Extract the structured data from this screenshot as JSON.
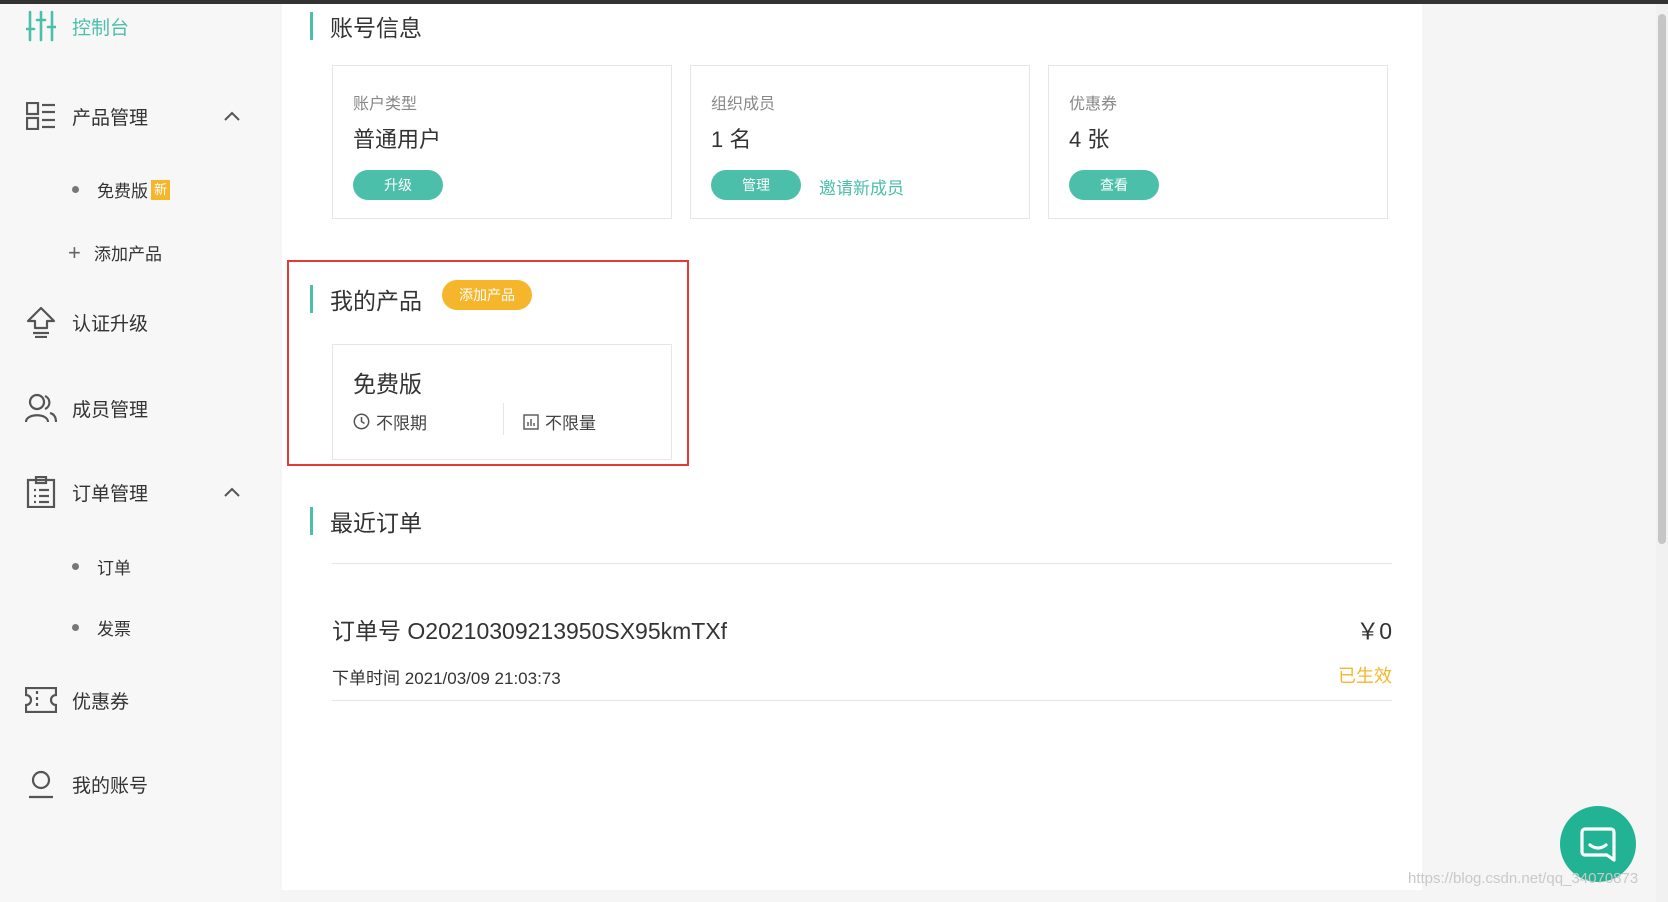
{
  "colors": {
    "accent": "#4cbfab",
    "warning": "#f5b62b",
    "highlight_border": "#e53935",
    "chat": "#21b394"
  },
  "sidebar": {
    "items": [
      {
        "label": "控制台",
        "icon": "dashboard-sliders-icon"
      },
      {
        "label": "产品管理",
        "icon": "product-list-icon"
      },
      {
        "label": "认证升级",
        "icon": "upgrade-arrow-icon"
      },
      {
        "label": "成员管理",
        "icon": "members-icon"
      },
      {
        "label": "订单管理",
        "icon": "order-clipboard-icon"
      },
      {
        "label": "优惠券",
        "icon": "coupon-ticket-icon"
      },
      {
        "label": "我的账号",
        "icon": "user-account-icon"
      }
    ],
    "product_sub": {
      "free": "免费版",
      "new_badge": "新",
      "add": "添加产品"
    },
    "order_sub": {
      "orders": "订单",
      "invoice": "发票"
    }
  },
  "account": {
    "title": "账号信息",
    "cards": [
      {
        "title": "账户类型",
        "value": "普通用户",
        "button": "升级"
      },
      {
        "title": "组织成员",
        "value": "1 名",
        "button": "管理",
        "link": "邀请新成员"
      },
      {
        "title": "优惠券",
        "value": "4 张",
        "button": "查看"
      }
    ]
  },
  "my_products": {
    "title": "我的产品",
    "add_button": "添加产品",
    "product": {
      "name": "免费版",
      "period": "不限期",
      "quota": "不限量"
    }
  },
  "recent_orders": {
    "title": "最近订单",
    "order": {
      "number_label": "订单号",
      "number": "O20210309213950SX95kmTXf",
      "amount": "￥0",
      "time_label": "下单时间",
      "time": "2021/03/09 21:03:73",
      "status": "已生效"
    }
  },
  "watermark": "https://blog.csdn.net/qq_34070873"
}
